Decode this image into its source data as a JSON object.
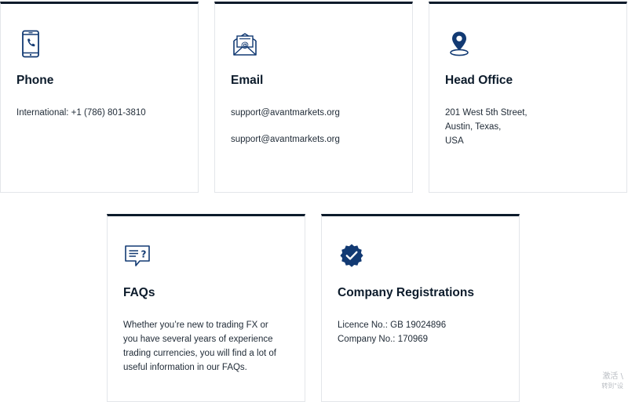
{
  "colors": {
    "accent": "#0c1b2b",
    "icon_blue": "#123a73",
    "border": "#e3e6ea",
    "text": "#1f2a36"
  },
  "cards": {
    "phone": {
      "icon": "mobile-phone-icon",
      "title": "Phone",
      "lines": [
        "International: +1 (786) 801-3810"
      ]
    },
    "email": {
      "icon": "envelope-at-icon",
      "title": "Email",
      "lines": [
        "support@avantmarkets.org",
        "support@avantmarkets.org"
      ]
    },
    "head_office": {
      "icon": "map-pin-icon",
      "title": "Head Office",
      "lines": [
        "201 West 5th Street,",
        "Austin, Texas,",
        "USA"
      ]
    },
    "faqs": {
      "icon": "chat-question-icon",
      "title": "FAQs",
      "text": "Whether you’re new to trading FX or you have several years of experience trading currencies, you will find a lot of useful information in our FAQs."
    },
    "registrations": {
      "icon": "verified-badge-icon",
      "title": "Company Registrations",
      "lines": [
        "Licence No.: GB 19024896",
        "Company No.: 170969"
      ]
    }
  },
  "watermark": {
    "line1": "激活 \\",
    "line2": "转到\"设"
  }
}
